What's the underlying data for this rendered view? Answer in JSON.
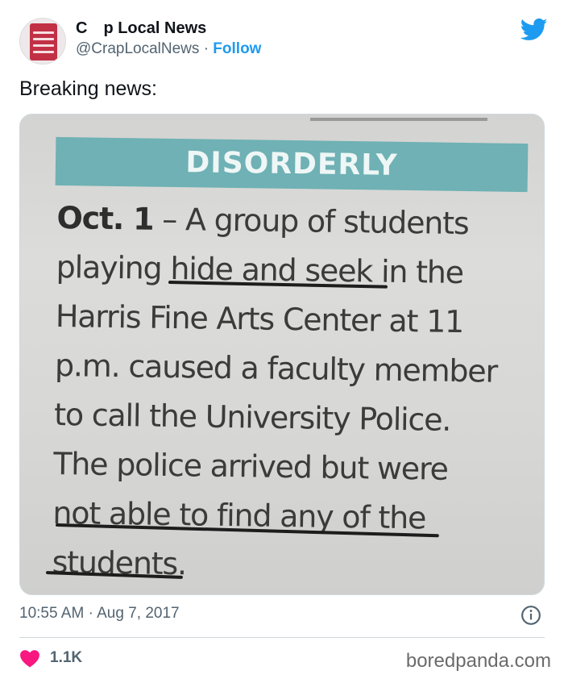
{
  "author": {
    "name": "C  p Local News",
    "handle": "@CrapLocalNews",
    "separator": "·",
    "follow_label": "Follow"
  },
  "tweet": {
    "text": "Breaking news:"
  },
  "clipping": {
    "banner": "DISORDERLY",
    "date": "Oct. 1",
    "lines": [
      "– A group of students",
      "playing hide and seek in the",
      "Harris Fine Arts Center at 11",
      "p.m. caused a faculty member",
      "to call the University Police.",
      "The police arrived but were",
      "not able to find any of the",
      "students."
    ]
  },
  "meta": {
    "time": "10:55 AM",
    "separator": "·",
    "date": "Aug 7, 2017"
  },
  "engagement": {
    "likes": "1.1K"
  },
  "watermark": "boredpanda.com",
  "icons": {
    "brand": "twitter-bird-icon",
    "info": "info-icon",
    "like": "heart-icon"
  },
  "colors": {
    "twitter_blue": "#1d9bf0",
    "like_red": "#f91880",
    "banner_teal": "#6fb1b4",
    "muted_text": "#536471"
  }
}
